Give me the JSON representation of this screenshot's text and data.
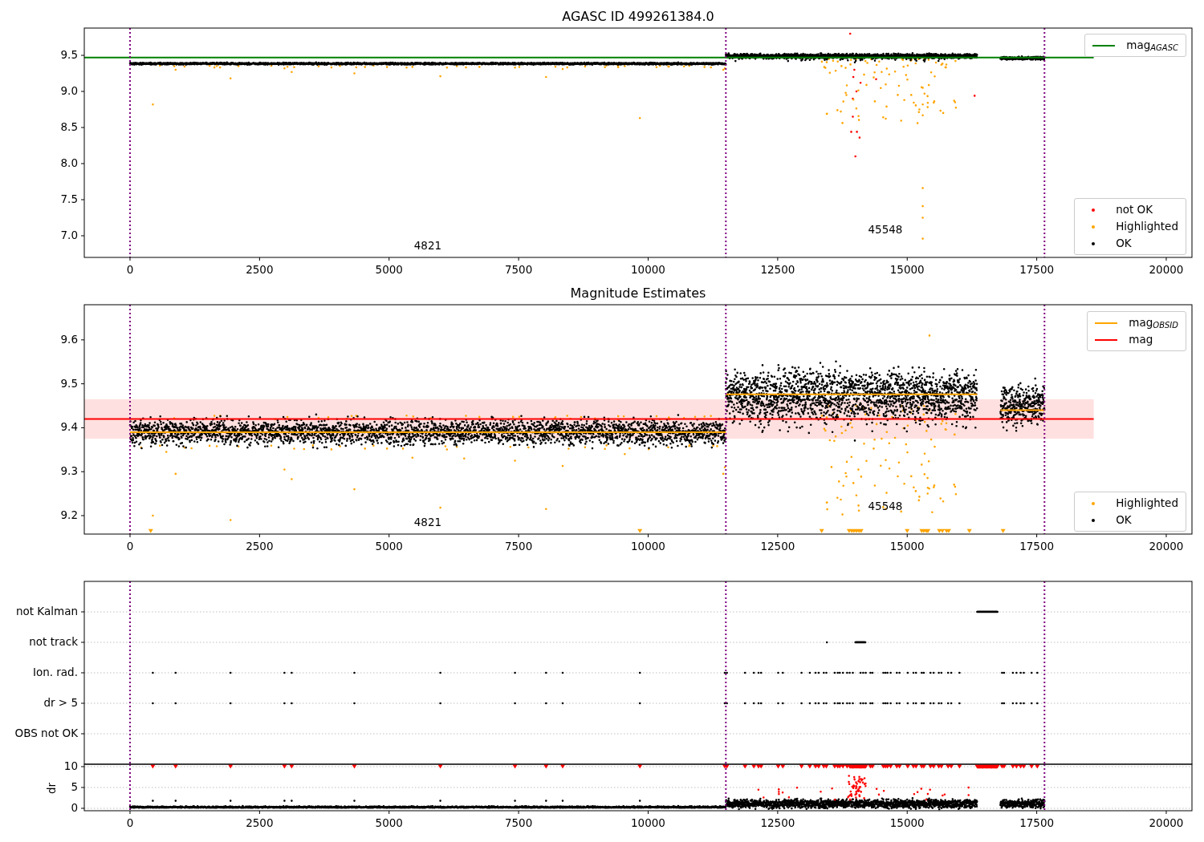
{
  "panels": [
    {
      "chart_data": {
        "type": "scatter",
        "title": "AGASC ID 499261384.0",
        "xlim": [
          -883,
          20496
        ],
        "ylim": [
          6.7,
          9.878
        ],
        "legend": "right",
        "xticks": [
          0,
          2500,
          5000,
          7500,
          10000,
          12500,
          15000,
          17500,
          20000
        ],
        "yticks": [
          {
            "value": 7,
            "label": "7.0"
          },
          {
            "value": 7.5,
            "label": "7.5"
          },
          {
            "value": 8,
            "label": "8.0"
          },
          {
            "value": 8.5,
            "label": "8.5"
          },
          {
            "value": 9,
            "label": "9.0"
          },
          {
            "value": 9.5,
            "label": "9.5"
          }
        ],
        "series": [
          {
            "name": "mag$_{AGASC}$",
            "type": "line",
            "color": "#008000",
            "x": [
              -883,
              18600
            ],
            "values": [
              9.47,
              9.47
            ]
          },
          {
            "name": "not OK",
            "type": "scatter",
            "color": "#ff0000"
          },
          {
            "name": "Highlighted",
            "type": "scatter",
            "color": "#ffa500"
          },
          {
            "name": "OK",
            "type": "scatter",
            "color": "#000000"
          }
        ],
        "ref_lines": [
          {
            "axis": "x",
            "value": 0,
            "color": "#800080"
          },
          {
            "axis": "x",
            "value": 11500,
            "color": "#800080"
          },
          {
            "axis": "x",
            "value": 17650,
            "color": "#800080"
          }
        ],
        "annotations": [
          "4821",
          "45548"
        ]
      }
    },
    {
      "chart_data": {
        "type": "scatter",
        "title": "Magnitude Estimates",
        "xlim": [
          -883,
          20496
        ],
        "ylim": [
          9.158,
          9.68
        ],
        "legend": "right",
        "xticks": [
          0,
          2500,
          5000,
          7500,
          10000,
          12500,
          15000,
          17500,
          20000
        ],
        "yticks": [
          {
            "value": 9.2,
            "label": "9.2"
          },
          {
            "value": 9.3,
            "label": "9.3"
          },
          {
            "value": 9.4,
            "label": "9.4"
          },
          {
            "value": 9.5,
            "label": "9.5"
          },
          {
            "value": 9.6,
            "label": "9.6"
          }
        ],
        "series": [
          {
            "name": "mag$_{OBSID}$",
            "type": "line",
            "color": "#ffa500",
            "x": [
              0,
              11500,
              null,
              11500,
              16350,
              null,
              16800,
              17650
            ],
            "values": [
              9.39,
              9.39,
              null,
              9.476,
              9.476,
              null,
              9.44,
              9.44
            ]
          },
          {
            "name": "mag",
            "type": "line",
            "color": "#ff0000",
            "x": [
              -883,
              18600
            ],
            "values": [
              9.42,
              9.42
            ]
          },
          {
            "name": "Highlighted",
            "type": "scatter",
            "color": "#ffa500"
          },
          {
            "name": "OK",
            "type": "scatter",
            "color": "#000000"
          }
        ],
        "bands": [
          {
            "axis": "y",
            "from": 9.375,
            "to": 9.465,
            "color": "#ff0000"
          }
        ],
        "ref_lines": [
          {
            "axis": "x",
            "value": 0,
            "color": "#800080"
          },
          {
            "axis": "x",
            "value": 11500,
            "color": "#800080"
          },
          {
            "axis": "x",
            "value": 17650,
            "color": "#800080"
          }
        ],
        "annotations": [
          "4821",
          "45548"
        ]
      }
    }
  ],
  "flag_panel": {
    "row_labels": [
      "not Kalman",
      "not track",
      "Ion. rad.",
      "dr > 5",
      "OBS not OK"
    ]
  },
  "dr_panel": {
    "ylabel": "dr",
    "y_tick_labels": [
      "10",
      "5",
      "0"
    ],
    "x_tick_labels": [
      "0",
      "2500",
      "5000",
      "7500",
      "10000",
      "12500",
      "15000",
      "17500",
      "20000"
    ]
  }
}
